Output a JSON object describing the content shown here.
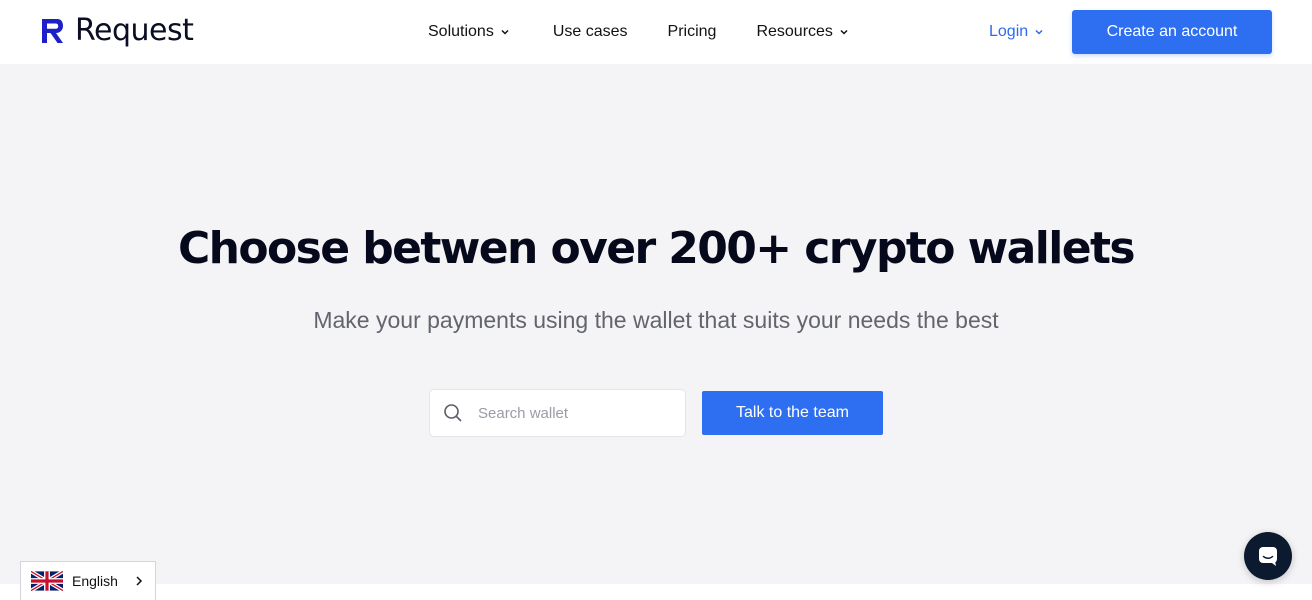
{
  "header": {
    "brand": "Request",
    "nav": [
      {
        "label": "Solutions",
        "has_dropdown": true
      },
      {
        "label": "Use cases",
        "has_dropdown": false
      },
      {
        "label": "Pricing",
        "has_dropdown": false
      },
      {
        "label": "Resources",
        "has_dropdown": true
      }
    ],
    "login_label": "Login",
    "cta_label": "Create an account"
  },
  "hero": {
    "title": "Choose betwen over 200+ crypto wallets",
    "subtitle": "Make your payments using the wallet that suits your needs the best",
    "search_placeholder": "Search wallet",
    "search_value": "",
    "button_label": "Talk to the team"
  },
  "language_selector": {
    "label": "English",
    "flag_icon": "uk-flag-icon"
  },
  "chat_widget": {
    "icon": "chat-icon"
  },
  "colors": {
    "accent": "#2e6ff2",
    "login": "#2c6bec",
    "hero_bg": "#f4f4f6",
    "title": "#06081b",
    "subtitle": "#62646e",
    "chat_bg": "#0b1a2e"
  }
}
